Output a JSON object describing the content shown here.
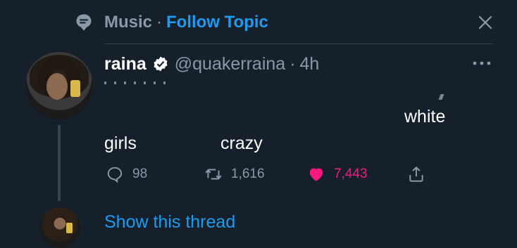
{
  "topic": {
    "icon": "topic-tag-icon",
    "label": "Music",
    "separator": "·",
    "follow_label": "Follow Topic",
    "close_icon": "close-icon"
  },
  "tweet": {
    "display_name": "raina",
    "verified_icon": "verified-badge-icon",
    "handle": "@quakerraina",
    "separator": "·",
    "time": "4h",
    "more_icon": "more-options-icon",
    "visible_words": {
      "word1": "white",
      "word2": "girls",
      "word3": "crazy"
    },
    "actions": {
      "reply": {
        "icon": "reply-icon",
        "count": "98"
      },
      "retweet": {
        "icon": "retweet-icon",
        "count": "1,616"
      },
      "like": {
        "icon": "heart-icon",
        "count": "7,443",
        "liked": true
      },
      "share": {
        "icon": "share-icon"
      }
    }
  },
  "thread": {
    "show_label": "Show this thread"
  },
  "colors": {
    "background": "#15202b",
    "accent": "#1d9bf0",
    "like": "#f91880",
    "muted": "#8b98a5"
  }
}
